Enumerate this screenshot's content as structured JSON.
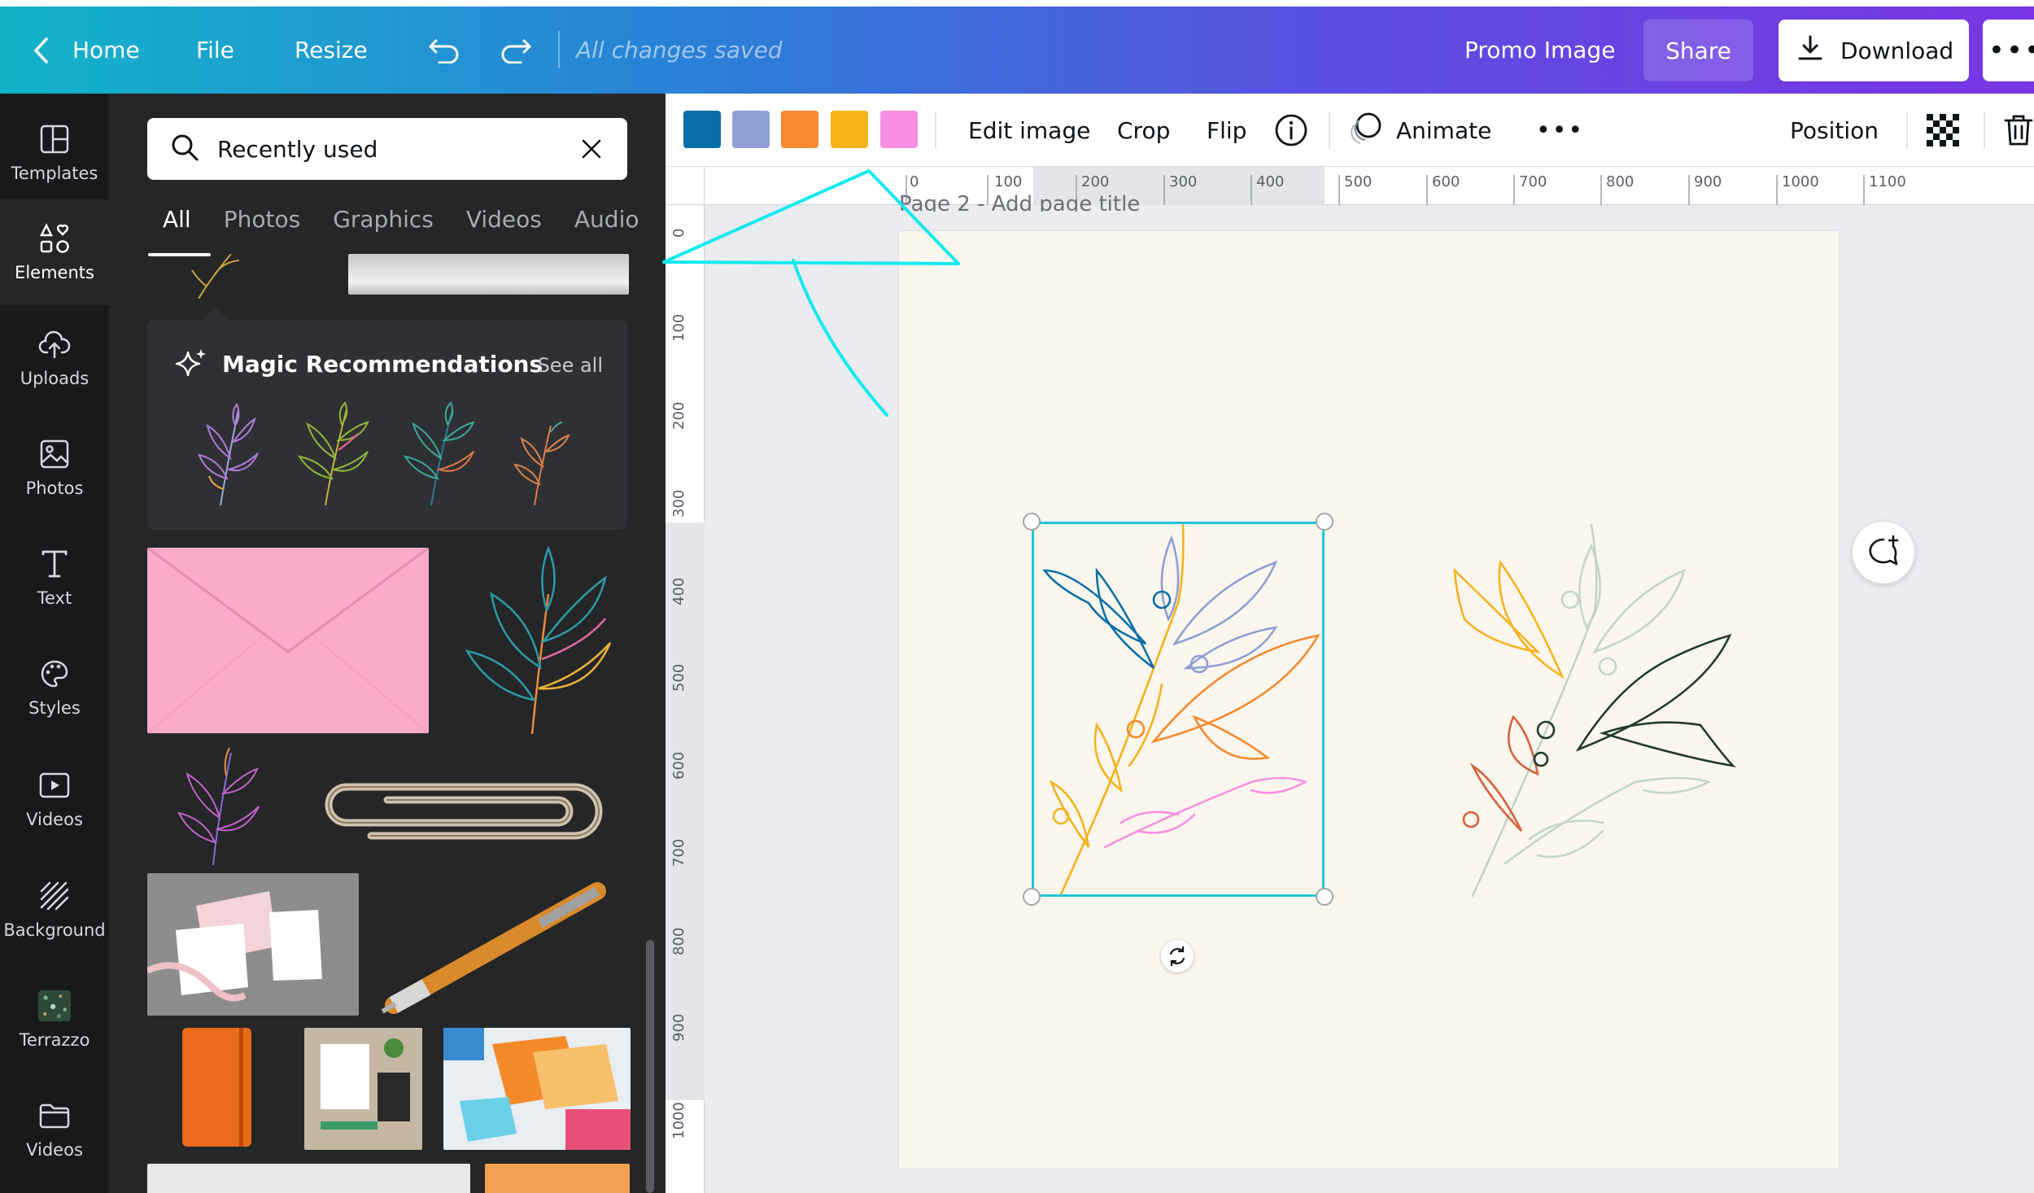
{
  "topbar": {
    "home": "Home",
    "file": "File",
    "resize": "Resize",
    "saved_status": "All changes saved",
    "design_title": "Promo Image",
    "share": "Share",
    "download": "Download",
    "more": "•••"
  },
  "rail": {
    "items": [
      {
        "label": "Templates",
        "icon": "templates-icon"
      },
      {
        "label": "Elements",
        "icon": "elements-icon"
      },
      {
        "label": "Uploads",
        "icon": "upload-cloud-icon"
      },
      {
        "label": "Photos",
        "icon": "photo-icon"
      },
      {
        "label": "Text",
        "icon": "text-icon"
      },
      {
        "label": "Styles",
        "icon": "palette-icon"
      },
      {
        "label": "Videos",
        "icon": "video-icon"
      },
      {
        "label": "Background",
        "icon": "background-pattern-icon"
      },
      {
        "label": "Terrazzo",
        "icon": "terrazzo-thumbnail"
      },
      {
        "label": "Videos",
        "icon": "folder-icon"
      }
    ]
  },
  "panel": {
    "search_value": "Recently used",
    "tabs": [
      "All",
      "Photos",
      "Graphics",
      "Videos",
      "Audio"
    ],
    "magic_title": "Magic Recommendations",
    "see_all": "See all"
  },
  "toolbar": {
    "colors": [
      "#0a6fa8",
      "#8f9fd5",
      "#f7892e",
      "#f8b31b",
      "#fa8fe2"
    ],
    "edit_image": "Edit image",
    "crop": "Crop",
    "flip": "Flip",
    "animate": "Animate",
    "more": "•••",
    "position": "Position"
  },
  "ruler": {
    "top": [
      "0",
      "100",
      "200",
      "300",
      "400",
      "500",
      "600",
      "700",
      "800",
      "900",
      "1000",
      "1100"
    ],
    "left": [
      "0",
      "100",
      "200",
      "300",
      "400",
      "500",
      "600",
      "700",
      "800",
      "900",
      "1000"
    ]
  },
  "canvas": {
    "page_title": "Page 2 - Add page title"
  }
}
